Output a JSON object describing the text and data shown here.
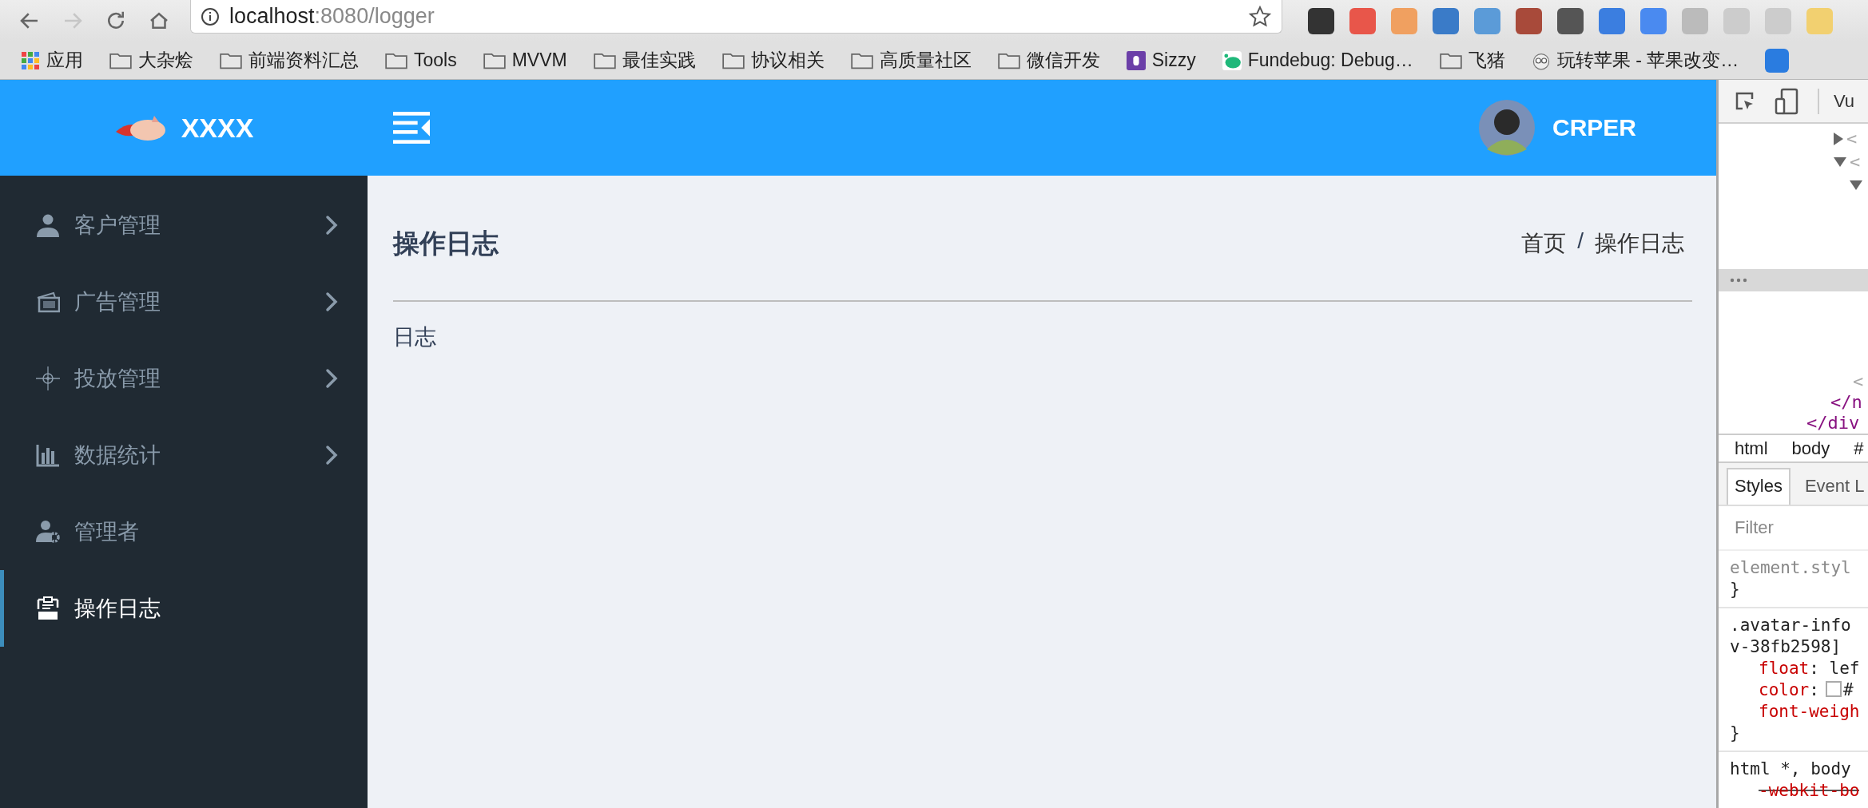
{
  "browser": {
    "nav_buttons": [
      {
        "kind": "back",
        "disabled": false
      },
      {
        "kind": "forward",
        "disabled": true
      },
      {
        "kind": "reload",
        "disabled": false
      },
      {
        "kind": "home",
        "disabled": false
      }
    ],
    "address": {
      "host": "localhost",
      "path": ":8080/logger"
    },
    "bookmarks": [
      {
        "kind": "apps",
        "label": "应用"
      },
      {
        "kind": "folder",
        "label": "大杂烩"
      },
      {
        "kind": "folder",
        "label": "前端资料汇总"
      },
      {
        "kind": "folder",
        "label": "Tools"
      },
      {
        "kind": "folder",
        "label": "MVVM"
      },
      {
        "kind": "folder",
        "label": "最佳实践"
      },
      {
        "kind": "folder",
        "label": "协议相关"
      },
      {
        "kind": "folder",
        "label": "高质量社区"
      },
      {
        "kind": "folder",
        "label": "微信开发"
      },
      {
        "kind": "sizzy",
        "label": "Sizzy"
      },
      {
        "kind": "fundebug",
        "label": "Fundebug: Debug…"
      },
      {
        "kind": "folder",
        "label": "飞猪"
      },
      {
        "kind": "apple",
        "label": "玩转苹果 - 苹果改变…"
      }
    ]
  },
  "app": {
    "brand": "XXXX",
    "user": "CRPER",
    "menu": [
      {
        "kind": "user",
        "label": "客户管理",
        "expandable": true,
        "selected": false
      },
      {
        "kind": "ad",
        "label": "广告管理",
        "expandable": true,
        "selected": false
      },
      {
        "kind": "target",
        "label": "投放管理",
        "expandable": true,
        "selected": false
      },
      {
        "kind": "chart",
        "label": "数据统计",
        "expandable": true,
        "selected": false
      },
      {
        "kind": "admin",
        "label": "管理者",
        "expandable": false,
        "selected": false
      },
      {
        "kind": "log",
        "label": "操作日志",
        "expandable": false,
        "selected": true
      }
    ],
    "page_title": "操作日志",
    "breadcrumb": [
      {
        "label": "首页"
      },
      {
        "label": "操作日志"
      }
    ],
    "breadcrumb_separator": "/",
    "content": "日志"
  },
  "devtools": {
    "tab": "Vu",
    "tree": [
      {
        "kind": "collapsed",
        "text": "<"
      },
      {
        "kind": "expanded",
        "text": "<",
        "children": [
          {
            "kind": "expanded"
          }
        ]
      }
    ],
    "closing_lines": [
      {
        "text": "<"
      },
      {
        "text": "</n"
      },
      {
        "text": "</div"
      }
    ],
    "path": [
      "html",
      "body",
      "#"
    ],
    "tabs": [
      {
        "label": "Styles",
        "selected": true
      },
      {
        "label": "Event L",
        "selected": false
      }
    ],
    "filter": {
      "placeholder": "Filter"
    },
    "rules": [
      {
        "selector": [
          "element.styl"
        ],
        "close": "}"
      },
      {
        "selector": [
          ".avatar-info",
          "v-38fb2598]"
        ],
        "declarations": [
          {
            "property": "float",
            "rest": ": lef",
            "swatch": false,
            "struck": false
          },
          {
            "property": "color",
            "rest": ":",
            "swatch": true,
            "after": "#",
            "struck": false
          },
          {
            "property": "font-weigh",
            "swatch": false,
            "struck": false
          }
        ],
        "close": "}"
      },
      {
        "selector": [
          "html *, body"
        ],
        "declarations": [
          {
            "property": "-webkit-bo",
            "swatch": false,
            "struck": true
          }
        ]
      }
    ]
  }
}
